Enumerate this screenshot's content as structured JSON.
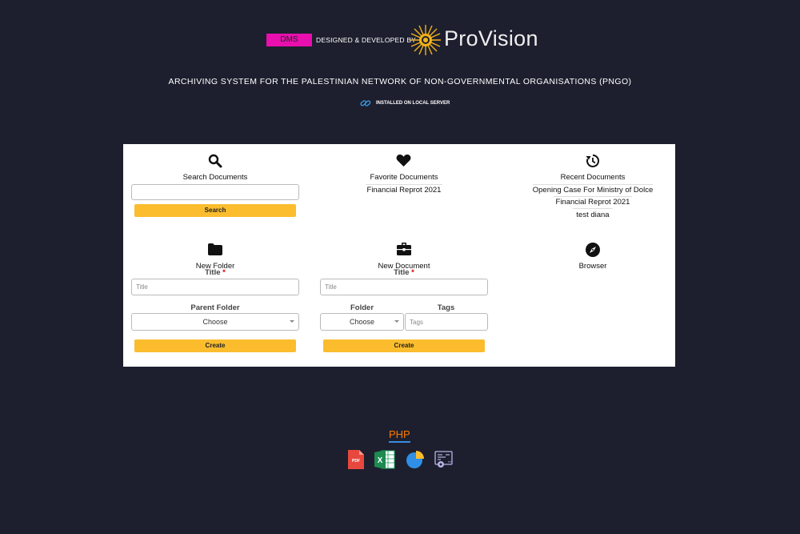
{
  "header": {
    "badge": "DMS",
    "designed_by": "DESIGNED & DEVELOPED BY",
    "brand": "ProVision",
    "subtitle": "ARCHIVING SYSTEM FOR THE PALESTINIAN NETWORK OF NON-GOVERNMENTAL ORGANISATIONS (PNGO)",
    "server_status": "INSTALLED ON LOCAL SERVER"
  },
  "colors": {
    "background": "#1d1f2e",
    "badge": "#e80fae",
    "button": "#fbbd2e",
    "php": "#ff7a00"
  },
  "search": {
    "icon": "search-icon",
    "title": "Search Documents",
    "input_value": "",
    "button": "Search"
  },
  "favorites": {
    "icon": "heart-icon",
    "title": "Favorite Documents",
    "items": [
      "Financial Reprot 2021"
    ]
  },
  "recent": {
    "icon": "history-icon",
    "title": "Recent Documents",
    "items": [
      "Opening Case For Ministry of Dolce",
      "Financial Reprot 2021",
      "test diana"
    ]
  },
  "new_folder": {
    "icon": "folder-icon",
    "title": "New Folder",
    "title_label": "Title",
    "required_mark": "*",
    "title_placeholder": "Title",
    "parent_label": "Parent Folder",
    "parent_value": "Choose",
    "button": "Create"
  },
  "new_document": {
    "icon": "briefcase-icon",
    "title": "New Document",
    "title_label": "Title",
    "required_mark": "*",
    "title_placeholder": "Title",
    "folder_label": "Folder",
    "folder_value": "Choose",
    "tags_label": "Tags",
    "tags_placeholder": "Tags",
    "button": "Create"
  },
  "browser": {
    "icon": "compass-icon",
    "title": "Browser"
  },
  "footer": {
    "tech": "PHP",
    "export_icons": [
      "pdf-icon",
      "excel-icon",
      "pie-chart-icon",
      "settings-report-icon"
    ],
    "pdf_text": "PDF",
    "excel_text": "X"
  }
}
